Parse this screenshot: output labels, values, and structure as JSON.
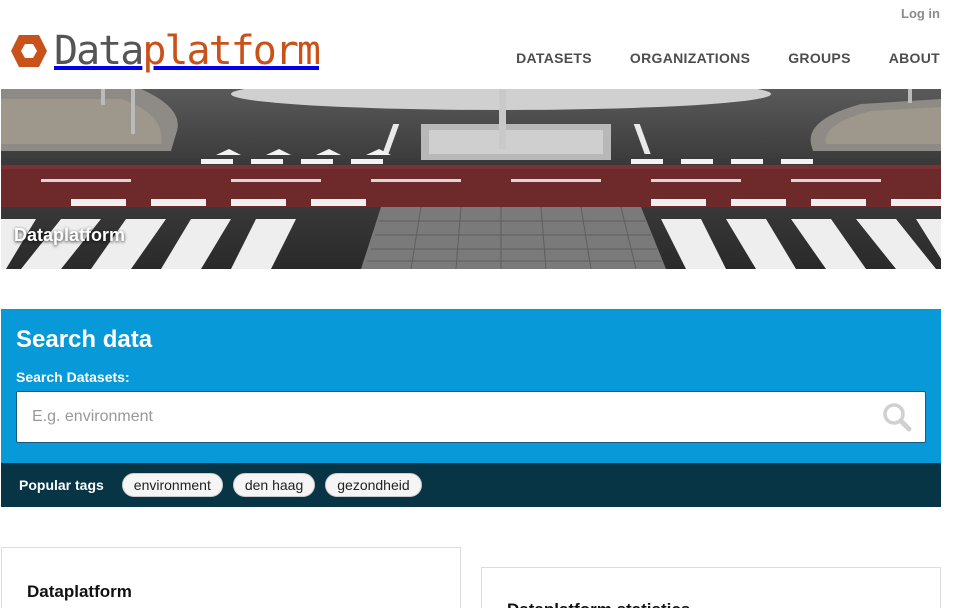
{
  "header": {
    "login_label": "Log in",
    "logo": {
      "part1": "Data",
      "part2": "platform",
      "brand_color": "#c9521b",
      "icon": "hexagon-logo-icon"
    },
    "nav": [
      {
        "label": "DATASETS"
      },
      {
        "label": "ORGANIZATIONS"
      },
      {
        "label": "GROUPS"
      },
      {
        "label": "ABOUT"
      }
    ]
  },
  "hero": {
    "title": "Dataplatform"
  },
  "search": {
    "title": "Search data",
    "label": "Search Datasets:",
    "placeholder": "E.g. environment",
    "value": "",
    "button_icon": "search-icon",
    "bg_color": "#0799d8"
  },
  "tags": {
    "label": "Popular tags",
    "items": [
      {
        "label": "environment"
      },
      {
        "label": "den haag"
      },
      {
        "label": "gezondheid"
      }
    ],
    "bg_color": "#073545"
  },
  "boxes": {
    "intro_title": "Dataplatform",
    "stats_title": "Dataplatform statistics"
  }
}
